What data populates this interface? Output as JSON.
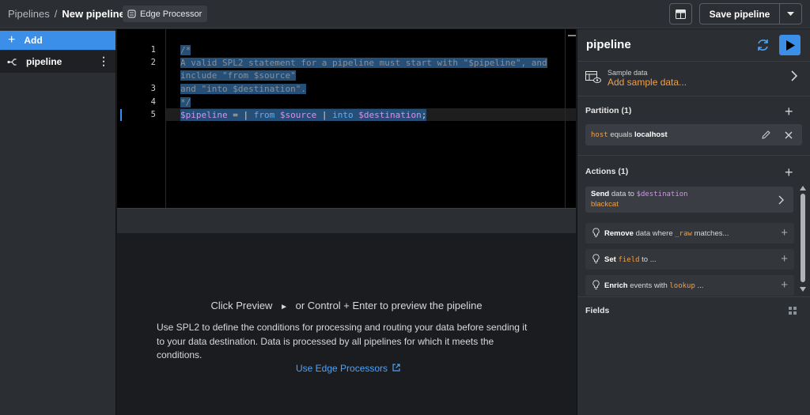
{
  "breadcrumb": {
    "root": "Pipelines",
    "separator": "/",
    "current": "New pipeline"
  },
  "chip": {
    "label": "Edge Processor",
    "icon": "edge-processor-icon"
  },
  "toolbar": {
    "save_label": "Save pipeline"
  },
  "sidebar": {
    "add_label": "Add",
    "pipeline_label": "pipeline"
  },
  "editor": {
    "line_numbers": [
      "1",
      "2",
      "3",
      "4",
      "5"
    ],
    "line1": "/*",
    "line2a": "A valid SPL2 statement for a pipeline must start with \"$pipeline\", and",
    "line2b": "include \"from $source\"",
    "line3": "and \"into $destination\".",
    "line4": "*/",
    "line5": {
      "v1": "$pipeline",
      "eq": " = | ",
      "kw1": "from",
      "v2": " $source",
      "bar": " | ",
      "kw2": "into",
      "v3": " $destination",
      "end": ";"
    }
  },
  "preview": {
    "title_a": "Click Preview",
    "title_glyph": "►",
    "title_b": "or Control + Enter to preview the pipeline",
    "description": "Use SPL2 to define the conditions for processing and routing your data before sending it to your data destination. Data is processed by all pipelines for which it meets the conditions.",
    "link": "Use Edge Processors"
  },
  "panel": {
    "title": "pipeline",
    "sample": {
      "label": "Sample data",
      "value": "Add sample data..."
    },
    "partition": {
      "heading": "Partition (1)",
      "field": "host",
      "operator": "equals",
      "value": "localhost"
    },
    "actions": {
      "heading": "Actions (1)",
      "send": {
        "verb": "Send",
        "mid": "data to",
        "dest": "$destination",
        "target": "blackcat"
      },
      "items": [
        {
          "verb": "Remove",
          "mid": "data where",
          "code": "_raw",
          "tail": "matches..."
        },
        {
          "verb": "Set",
          "mid": "",
          "code": "field",
          "tail": "to ..."
        },
        {
          "verb": "Enrich",
          "mid": "events with",
          "code": "lookup",
          "tail": "..."
        }
      ]
    },
    "fields_heading": "Fields"
  },
  "colors": {
    "accent": "#3b8fe8",
    "orange": "#f0a04a",
    "purple": "#d98ff0",
    "selection": "#264f78"
  }
}
